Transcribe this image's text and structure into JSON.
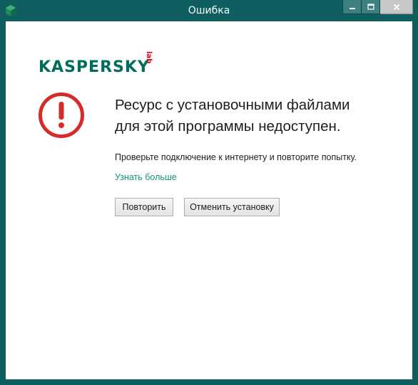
{
  "window": {
    "title": "Ошибка",
    "controls": {
      "minimize_icon": "minimize-icon",
      "maximize_icon": "maximize-icon",
      "close_icon": "close-icon"
    }
  },
  "logo": {
    "brand": "KASPERSKY",
    "suffix": "lab"
  },
  "error": {
    "icon": "error-exclamation-icon",
    "headline_line1": "Ресурс с установочными файлами",
    "headline_line2": "для этой программы недоступен.",
    "detail": "Проверьте подключение к интернету и повторите попытку.",
    "learn_more": "Узнать больше"
  },
  "buttons": {
    "retry_label": "Повторить",
    "cancel_label": "Отменить установку"
  },
  "colors": {
    "titlebar": "#0f5e60",
    "brand_green": "#006d5b",
    "error_red": "#d52b2b",
    "link": "#16937e"
  }
}
